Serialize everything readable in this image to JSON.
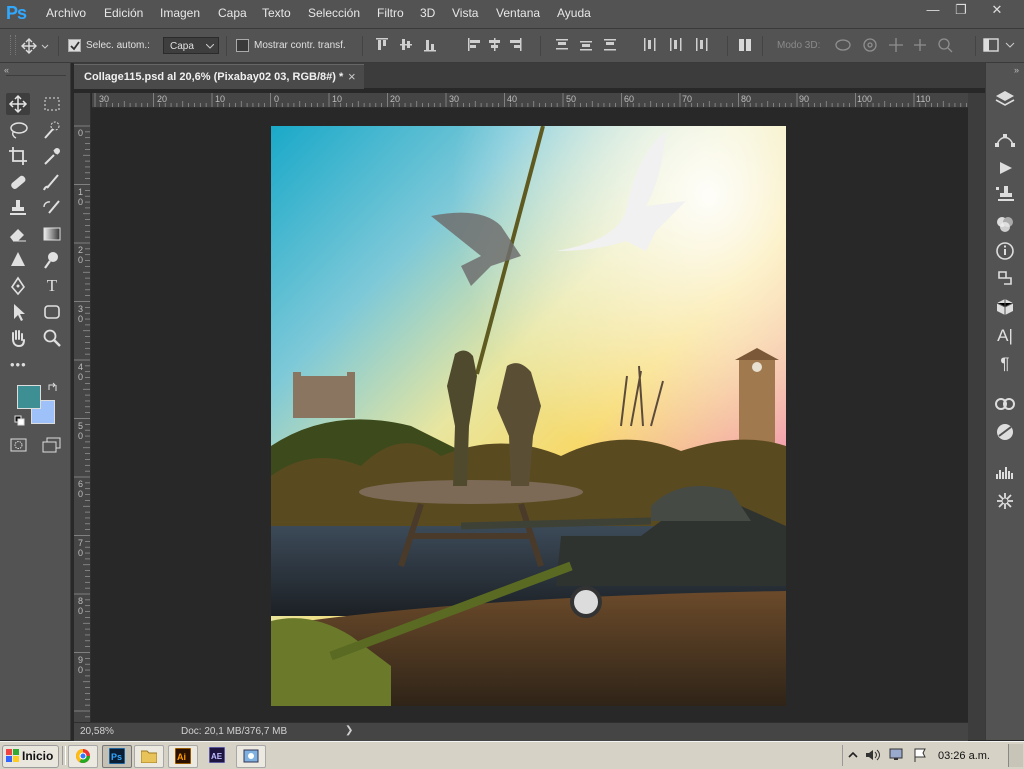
{
  "app": {
    "logo": "Ps"
  },
  "menu": [
    "Archivo",
    "Edición",
    "Imagen",
    "Capa",
    "Texto",
    "Selección",
    "Filtro",
    "3D",
    "Vista",
    "Ventana",
    "Ayuda"
  ],
  "window_controls": {
    "minimize": "—",
    "restore": "❐",
    "close": "✕"
  },
  "options": {
    "auto_select_checked": true,
    "auto_select_label": "Selec. autom.:",
    "auto_select_target": "Capa",
    "show_transform_checked": false,
    "show_transform_label": "Mostrar contr. transf.",
    "mode3d_label": "Modo 3D:"
  },
  "document": {
    "tab_title": "Collage115.psd al 20,6% (Pixabay02 03, RGB/8#) *",
    "close": "×"
  },
  "rulers": {
    "h_labels": [
      "30",
      "20",
      "10",
      "0",
      "10",
      "20",
      "30",
      "40",
      "50",
      "60",
      "70",
      "80",
      "90",
      "100",
      "110"
    ],
    "v_labels": [
      [
        "0"
      ],
      [
        "1",
        "0"
      ],
      [
        "2",
        "0"
      ],
      [
        "3",
        "0"
      ],
      [
        "4",
        "0"
      ],
      [
        "5",
        "0"
      ],
      [
        "6",
        "0"
      ],
      [
        "7",
        "0"
      ],
      [
        "8",
        "0"
      ],
      [
        "9",
        "0"
      ]
    ]
  },
  "status": {
    "zoom": "20,58%",
    "doc": "Doc: 20,1 MB/376,7 MB",
    "arrow": "❯"
  },
  "colors": {
    "foreground": "#3d8f94",
    "background": "#9ec1fa",
    "ui_dark": "#282828",
    "ui_panel": "#535353"
  },
  "taskbar": {
    "start": "Inicio",
    "clock": "03:26 a.m."
  },
  "tools": [
    "move-tool",
    "marquee-tool",
    "lasso-tool",
    "quick-select-tool",
    "crop-tool",
    "eyedropper-tool",
    "healing-tool",
    "brush-tool",
    "stamp-tool",
    "history-brush-tool",
    "eraser-tool",
    "gradient-tool",
    "blur-tool",
    "dodge-tool",
    "pen-tool",
    "type-tool",
    "path-select-tool",
    "shape-tool",
    "hand-tool",
    "zoom-tool"
  ],
  "panel_icons": [
    "layers-icon",
    "paths-icon",
    "actions-icon",
    "clone-source-icon",
    "adjustments-icon",
    "info-icon",
    "history-icon",
    "3d-icon",
    "character-icon",
    "paragraph-icon",
    "cc-libraries-icon",
    "properties-icon",
    "histogram-icon",
    "navigator-icon"
  ]
}
